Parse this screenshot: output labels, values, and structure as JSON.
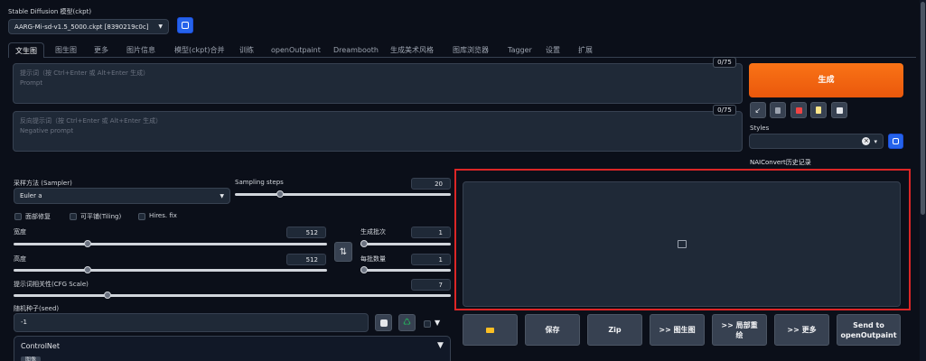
{
  "model": {
    "label": "Stable Diffusion 模型(ckpt)",
    "value": "AARG-Mi-sd-v1.5_5000.ckpt [8390219c0c]"
  },
  "tabs": [
    "文生图",
    "图生图",
    "更多",
    "图片信息",
    "模型(ckpt)合并",
    "训练",
    "openOutpaint",
    "Dreambooth",
    "生成美术风格",
    "图库浏览器",
    "Tagger",
    "设置",
    "扩展"
  ],
  "prompt": {
    "counter": "0/75",
    "placeholder_cn": "提示词（按 Ctrl+Enter 或 Alt+Enter 生成）",
    "placeholder_en": "Prompt"
  },
  "negative_prompt": {
    "counter": "0/75",
    "placeholder_cn": "反向提示词（按 Ctrl+Enter 或 Alt+Enter 生成）",
    "placeholder_en": "Negative prompt"
  },
  "generate_label": "生成",
  "styles": {
    "label": "Styles",
    "clear_icon": "×",
    "dropdown_icon": "▾"
  },
  "nai_label": "NAIConvert历史记录",
  "sampler": {
    "label": "采样方法 (Sampler)",
    "value": "Euler a"
  },
  "steps": {
    "label": "Sampling steps",
    "value": "20",
    "fraction": 0.2
  },
  "checkboxes": [
    "面部修复",
    "可平铺(Tiling)",
    "Hires. fix"
  ],
  "width": {
    "label": "宽度",
    "value": "512",
    "fraction": 0.23
  },
  "height": {
    "label": "高度",
    "value": "512",
    "fraction": 0.23
  },
  "batch_count": {
    "label": "生成批次",
    "value": "1",
    "fraction": 0.0
  },
  "batch_size": {
    "label": "每批数量",
    "value": "1",
    "fraction": 0.0
  },
  "cfg": {
    "label": "提示词相关性(CFG Scale)",
    "value": "7",
    "fraction": 0.21
  },
  "seed": {
    "label": "随机种子(seed)",
    "value": "-1"
  },
  "controlnet": {
    "label": "ControlNet",
    "arrow": "▼",
    "sub": "图像"
  },
  "swap_icon": "⇅",
  "dropdown_arrow": "▼",
  "output_buttons": [
    "保存",
    "Zip",
    ">> 图生图",
    ">> 局部重绘",
    ">> 更多",
    "Send to openOutpaint"
  ],
  "colors": {
    "accent": "#f97316",
    "highlight_border": "#dc2626",
    "background": "#0b0f19"
  }
}
